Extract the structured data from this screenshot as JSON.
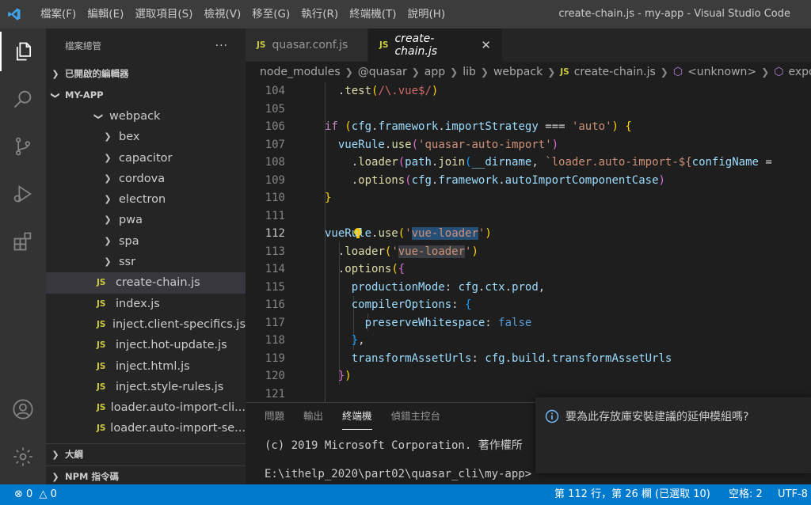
{
  "window": {
    "title": "create-chain.js - my-app - Visual Studio Code"
  },
  "menu": [
    {
      "label": "檔案(F)"
    },
    {
      "label": "編輯(E)"
    },
    {
      "label": "選取項目(S)"
    },
    {
      "label": "檢視(V)"
    },
    {
      "label": "移至(G)"
    },
    {
      "label": "執行(R)"
    },
    {
      "label": "終端機(T)"
    },
    {
      "label": "說明(H)"
    }
  ],
  "activity_bar": [
    "explorer-icon",
    "search-icon",
    "source-control-icon",
    "run-debug-icon",
    "extensions-icon",
    "account-icon",
    "settings-gear-icon"
  ],
  "sidebar": {
    "header": "檔案總管",
    "more": "···",
    "open_editors": "已開啟的編輯器",
    "project": "MY-APP",
    "folder": "webpack",
    "tree": [
      {
        "label": "bex",
        "type": "folder"
      },
      {
        "label": "capacitor",
        "type": "folder"
      },
      {
        "label": "cordova",
        "type": "folder"
      },
      {
        "label": "electron",
        "type": "folder"
      },
      {
        "label": "pwa",
        "type": "folder"
      },
      {
        "label": "spa",
        "type": "folder"
      },
      {
        "label": "ssr",
        "type": "folder"
      },
      {
        "label": "create-chain.js",
        "type": "js",
        "selected": true
      },
      {
        "label": "index.js",
        "type": "js"
      },
      {
        "label": "inject.client-specifics.js",
        "type": "js"
      },
      {
        "label": "inject.hot-update.js",
        "type": "js"
      },
      {
        "label": "inject.html.js",
        "type": "js"
      },
      {
        "label": "inject.style-rules.js",
        "type": "js"
      },
      {
        "label": "loader.auto-import-cli...",
        "type": "js"
      },
      {
        "label": "loader.auto-import-se...",
        "type": "js"
      }
    ],
    "js_badge": "JS",
    "outline": "大綱",
    "npm_scripts": "NPM 指令碼"
  },
  "tabs": [
    {
      "label": "quasar.conf.js",
      "active": false
    },
    {
      "label": "create-chain.js",
      "active": true
    }
  ],
  "breadcrumb": {
    "items": [
      "node_modules",
      "@quasar",
      "app",
      "lib",
      "webpack",
      "create-chain.js",
      "<unknown>",
      "expor"
    ]
  },
  "editor": {
    "line_numbers": [
      "104",
      "105",
      "106",
      "107",
      "108",
      "109",
      "110",
      "111",
      "112",
      "113",
      "114",
      "115",
      "116",
      "117",
      "118",
      "119",
      "120",
      "121"
    ]
  },
  "panel": {
    "tabs": [
      "問題",
      "輸出",
      "終端機",
      "偵錯主控台"
    ],
    "active_tab": "終端機",
    "terminal_line_1": "(c) 2019 Microsoft Corporation. 著作權所",
    "terminal_line_2": "E:\\ithelp_2020\\part02\\quasar_cli\\my-app>"
  },
  "notification": {
    "message": "要為此存放庫安裝建議的延伸模組嗎?"
  },
  "status_bar": {
    "errors": "0",
    "warnings": "0",
    "position": "第 112 行，第 26 欄 (已選取 10)",
    "indent": "空格: 2",
    "encoding": "UTF-8"
  },
  "colors": {
    "accent": "#007acc",
    "title_bar": "#3c3c3c",
    "editor_bg": "#1e1e1e"
  }
}
